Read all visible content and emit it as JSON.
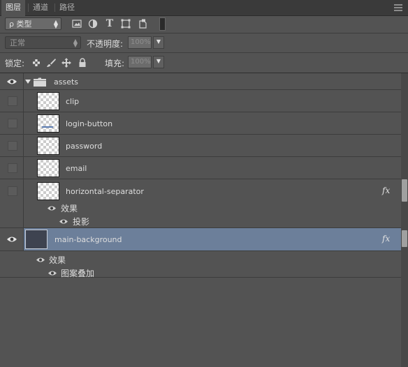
{
  "tabs": [
    {
      "label": "图层",
      "active": true
    },
    {
      "label": "通道",
      "active": false
    },
    {
      "label": "路径",
      "active": false
    }
  ],
  "filter": {
    "label": "ρ 类型"
  },
  "blend_mode": {
    "value": "正常"
  },
  "opacity": {
    "label": "不透明度:",
    "value": "100%"
  },
  "lock": {
    "label": "锁定:"
  },
  "fill": {
    "label": "填充:",
    "value": "100%"
  },
  "layers": {
    "group_name": "assets",
    "items": [
      {
        "name": "clip"
      },
      {
        "name": "login-button"
      },
      {
        "name": "password"
      },
      {
        "name": "email"
      },
      {
        "name": "horizontal-separator",
        "fx": "fx",
        "effects_label": "效果",
        "effect": "投影"
      },
      {
        "name": "main-background",
        "fx": "fx",
        "effects_label": "效果",
        "effect": "图案叠加"
      }
    ]
  },
  "colors": {
    "panel": "#535353",
    "selected_row": "#6c7f9a",
    "tabbar": "#3a3a3a"
  }
}
